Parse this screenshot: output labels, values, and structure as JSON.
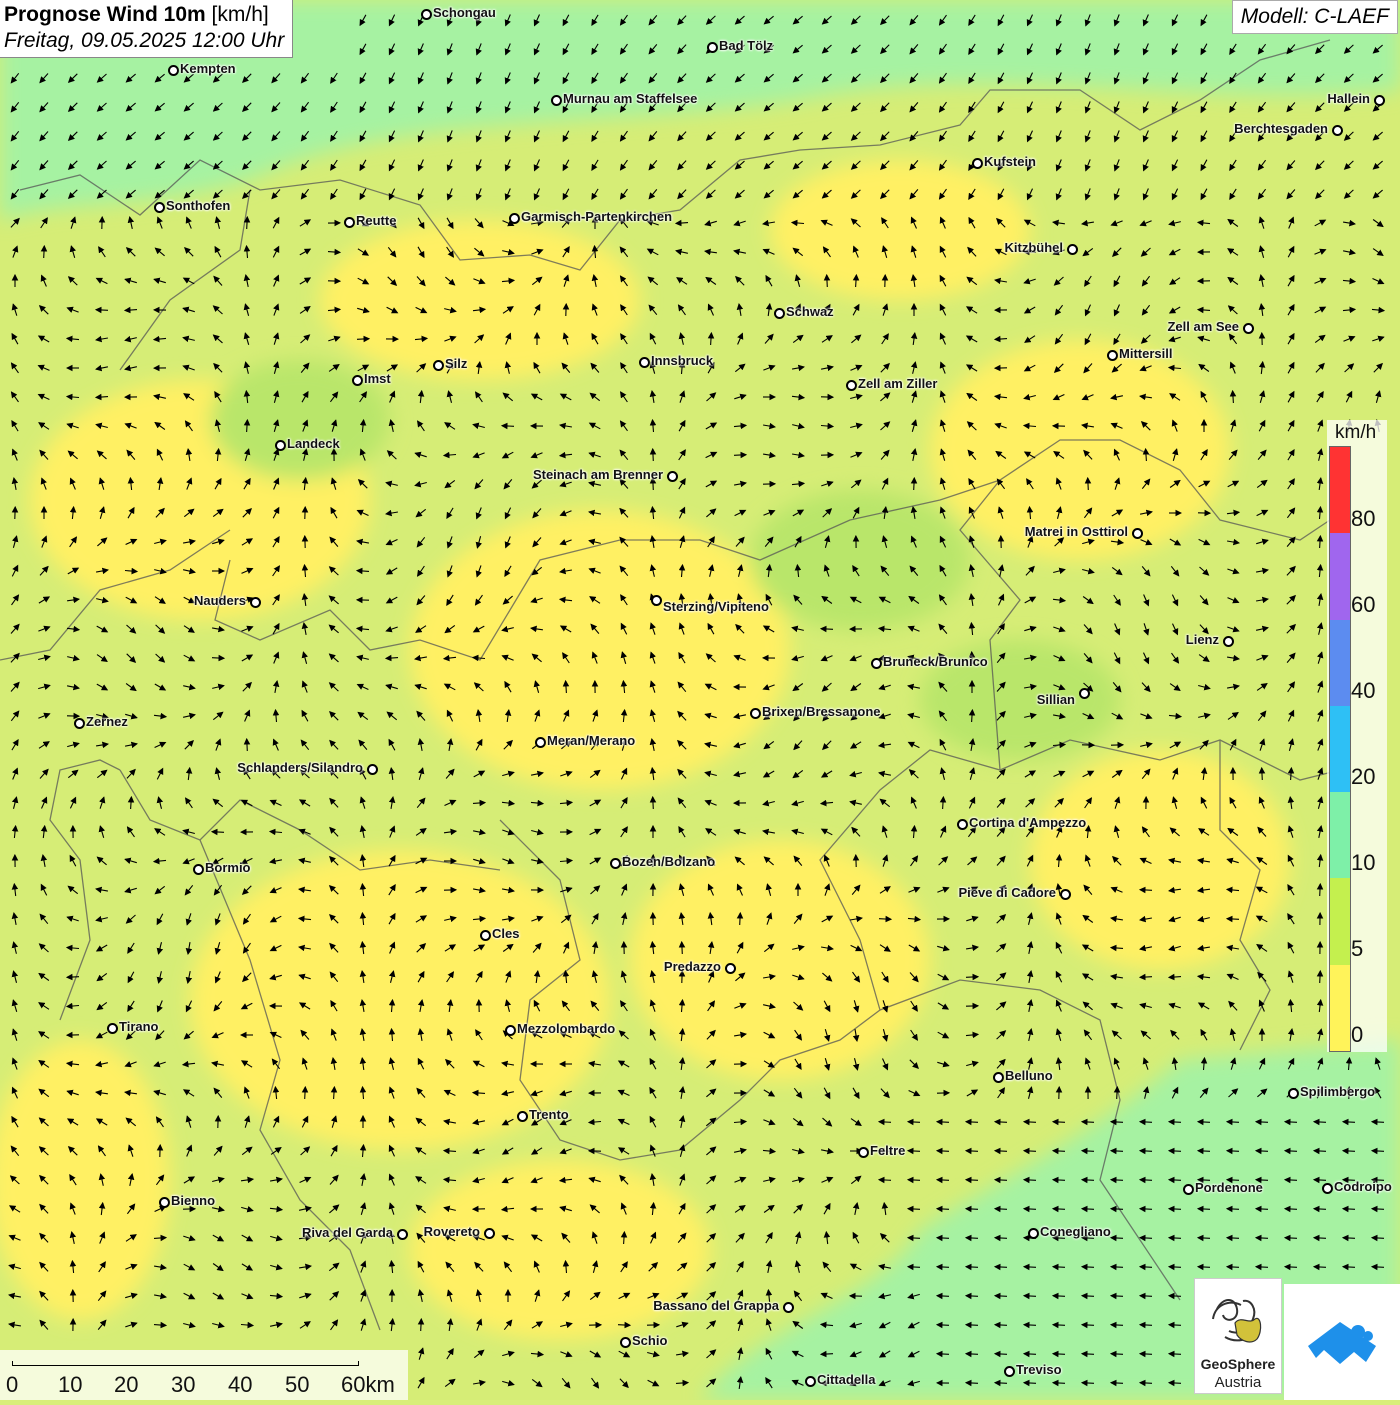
{
  "title": {
    "main": "Prognose Wind 10m",
    "unit": "[km/h]",
    "datetime": "Freitag, 09.05.2025 12:00 Uhr"
  },
  "model": "Modell: C-LAEF",
  "legend": {
    "unit": "km/h",
    "ticks": [
      "80",
      "60",
      "40",
      "20",
      "10",
      "5",
      "0"
    ],
    "colors": [
      "#ff3333",
      "#a066ee",
      "#5c8cf0",
      "#2ec0f5",
      "#7ef0a8",
      "#c4f04e",
      "#fff35a"
    ]
  },
  "scalebar": {
    "labels": [
      "0",
      "10",
      "20",
      "30",
      "40",
      "50",
      "60km"
    ]
  },
  "logos": {
    "geosphere_line1": "GeoSphere",
    "geosphere_line2": "Austria"
  },
  "cities": [
    {
      "name": "Schongau"
    },
    {
      "name": "Bad Tölz"
    },
    {
      "name": "Kempten"
    },
    {
      "name": "Murnau am Staffelsee"
    },
    {
      "name": "Hallein"
    },
    {
      "name": "Berchtesgaden"
    },
    {
      "name": "Kufstein"
    },
    {
      "name": "Sonthofen"
    },
    {
      "name": "Reutte"
    },
    {
      "name": "Garmisch-Partenkirchen"
    },
    {
      "name": "Kitzbühel"
    },
    {
      "name": "Schwaz"
    },
    {
      "name": "Zell am See"
    },
    {
      "name": "Mittersill"
    },
    {
      "name": "Innsbruck"
    },
    {
      "name": "Silz"
    },
    {
      "name": "Imst"
    },
    {
      "name": "Zell am Ziller"
    },
    {
      "name": "Landeck"
    },
    {
      "name": "Steinach am Brenner"
    },
    {
      "name": "Matrei in Osttirol"
    },
    {
      "name": "Nauders"
    },
    {
      "name": "Sterzing/Vipiteno"
    },
    {
      "name": "Lienz"
    },
    {
      "name": "Bruneck/Brunico"
    },
    {
      "name": "Sillian"
    },
    {
      "name": "Brixen/Bressanone"
    },
    {
      "name": "Zernez"
    },
    {
      "name": "Meran/Merano"
    },
    {
      "name": "Schlanders/Silandro"
    },
    {
      "name": "Cortina d'Ampezzo"
    },
    {
      "name": "Bozen/Bolzano"
    },
    {
      "name": "Bormio"
    },
    {
      "name": "Pieve di Cadore"
    },
    {
      "name": "Cles"
    },
    {
      "name": "Predazzo"
    },
    {
      "name": "Tirano"
    },
    {
      "name": "Mezzolombardo"
    },
    {
      "name": "Belluno"
    },
    {
      "name": "Spilimbergo"
    },
    {
      "name": "Trento"
    },
    {
      "name": "Feltre"
    },
    {
      "name": "Pordenone"
    },
    {
      "name": "Codroipo"
    },
    {
      "name": "Bienno"
    },
    {
      "name": "Riva del Garda"
    },
    {
      "name": "Rovereto"
    },
    {
      "name": "Conegliano"
    },
    {
      "name": "Bassano del Grappa"
    },
    {
      "name": "Schio"
    },
    {
      "name": "Treviso"
    },
    {
      "name": "Cittadella"
    }
  ]
}
